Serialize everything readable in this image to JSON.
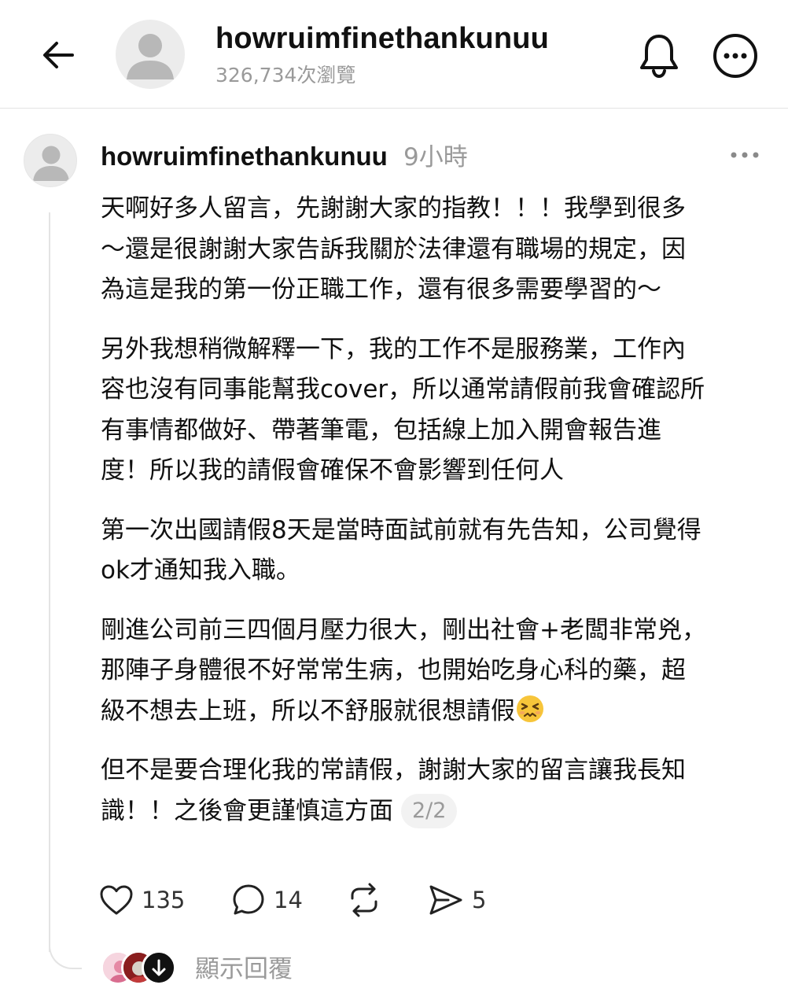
{
  "header": {
    "username": "howruimfinethankunuu",
    "views": "326,734次瀏覽",
    "icons": [
      "back-arrow-icon",
      "person-icon",
      "bell-icon",
      "more-horizontal-icon"
    ]
  },
  "post": {
    "author": "howruimfinethankunuu",
    "time": "9小時",
    "paragraphs": [
      [
        "天啊好多人留言，先謝謝大家的指教！！！我學到很多",
        "～還是很謝謝大家告訴我關於法律還有職場的規定，因",
        "為這是我的第一份正職工作，還有很多需要學習的～"
      ],
      [
        "另外我想稍微解釋一下，我的工作不是服務業，工作內",
        "容也沒有同事能幫我cover，所以通常請假前我會確認所",
        "有事情都做好、帶著筆電，包括線上加入開會報告進",
        "度！所以我的請假會確保不會影響到任何人"
      ],
      [
        "第一次出國請假8天是當時面試前就有先告知，公司覺得",
        "ok才通知我入職。"
      ],
      [
        "剛進公司前三四個月壓力很大，剛出社會+老闆非常兇，",
        "那陣子身體很不好常常生病，也開始吃身心科的藥，超",
        "級不想去上班，所以不舒服就很想請假"
      ],
      [
        "但不是要合理化我的常請假，謝謝大家的留言讓我長知",
        "識！！之後會更謹慎這方面"
      ]
    ],
    "page_indicator": "2/2",
    "emoji": "persevering-face-emoji"
  },
  "actions": {
    "likes": "135",
    "comments": "14",
    "shares": "5",
    "icons": [
      "heart-icon",
      "comment-icon",
      "repost-icon",
      "send-icon"
    ]
  },
  "replies": {
    "show_label": "顯示回覆"
  },
  "colors": {
    "text": "#111111",
    "muted": "#9a9a9a",
    "divider": "#e4e4e4",
    "avatar_bg": "#ececec",
    "avatar_fg": "#b8b8b8"
  }
}
